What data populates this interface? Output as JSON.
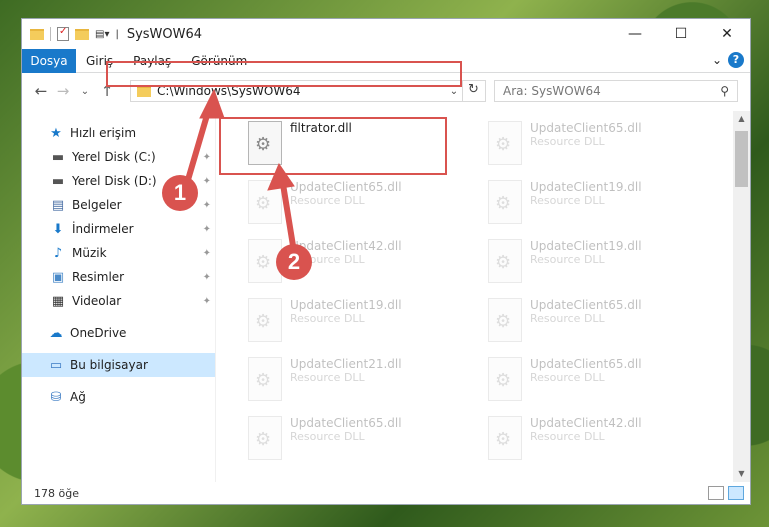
{
  "window": {
    "title": "SysWOW64",
    "minimize": "—",
    "maximize": "☐",
    "close": "✕"
  },
  "ribbon": {
    "tabs": [
      "Dosya",
      "Giriş",
      "Paylaş",
      "Görünüm"
    ],
    "expand": "⌄",
    "help": "?"
  },
  "nav": {
    "back": "←",
    "forward": "→",
    "recent": "⌄",
    "up": "↑"
  },
  "address": {
    "path": "C:\\Windows\\SysWOW64",
    "dropdown": "⌄",
    "refresh": "↻"
  },
  "search": {
    "placeholder": "Ara: SysWOW64"
  },
  "sidebar": {
    "items": [
      {
        "label": "Hızlı erişim",
        "icon": "star-icon",
        "pinned": false
      },
      {
        "label": "Yerel Disk (C:)",
        "icon": "drive-icon",
        "pinned": true
      },
      {
        "label": "Yerel Disk (D:)",
        "icon": "drive-icon",
        "pinned": true
      },
      {
        "label": "Belgeler",
        "icon": "documents-icon",
        "pinned": true
      },
      {
        "label": "İndirmeler",
        "icon": "download-icon",
        "pinned": true
      },
      {
        "label": "Müzik",
        "icon": "music-icon",
        "pinned": true
      },
      {
        "label": "Resimler",
        "icon": "pictures-icon",
        "pinned": true
      },
      {
        "label": "Videolar",
        "icon": "video-icon",
        "pinned": true
      },
      {
        "label": "OneDrive",
        "icon": "cloud-icon",
        "pinned": false
      },
      {
        "label": "Bu bilgisayar",
        "icon": "computer-icon",
        "pinned": false,
        "selected": true
      },
      {
        "label": "Ağ",
        "icon": "network-icon",
        "pinned": false
      }
    ]
  },
  "files": [
    {
      "name": "filtrator.dll",
      "type": ""
    },
    {
      "name": "UpdateClient65.dll",
      "type": "Resource DLL"
    },
    {
      "name": "UpdateClient65.dll",
      "type": "Resource DLL"
    },
    {
      "name": "UpdateClient19.dll",
      "type": "Resource DLL"
    },
    {
      "name": "UpdateClient42.dll",
      "type": "Resource DLL"
    },
    {
      "name": "UpdateClient19.dll",
      "type": "Resource DLL"
    },
    {
      "name": "UpdateClient19.dll",
      "type": "Resource DLL"
    },
    {
      "name": "UpdateClient65.dll",
      "type": "Resource DLL"
    },
    {
      "name": "UpdateClient21.dll",
      "type": "Resource DLL"
    },
    {
      "name": "UpdateClient65.dll",
      "type": "Resource DLL"
    },
    {
      "name": "UpdateClient65.dll",
      "type": "Resource DLL"
    },
    {
      "name": "UpdateClient42.dll",
      "type": "Resource DLL"
    }
  ],
  "status": {
    "count": "178 öğe"
  },
  "annotations": {
    "marker1": "1",
    "marker2": "2",
    "color": "#d9534f"
  }
}
